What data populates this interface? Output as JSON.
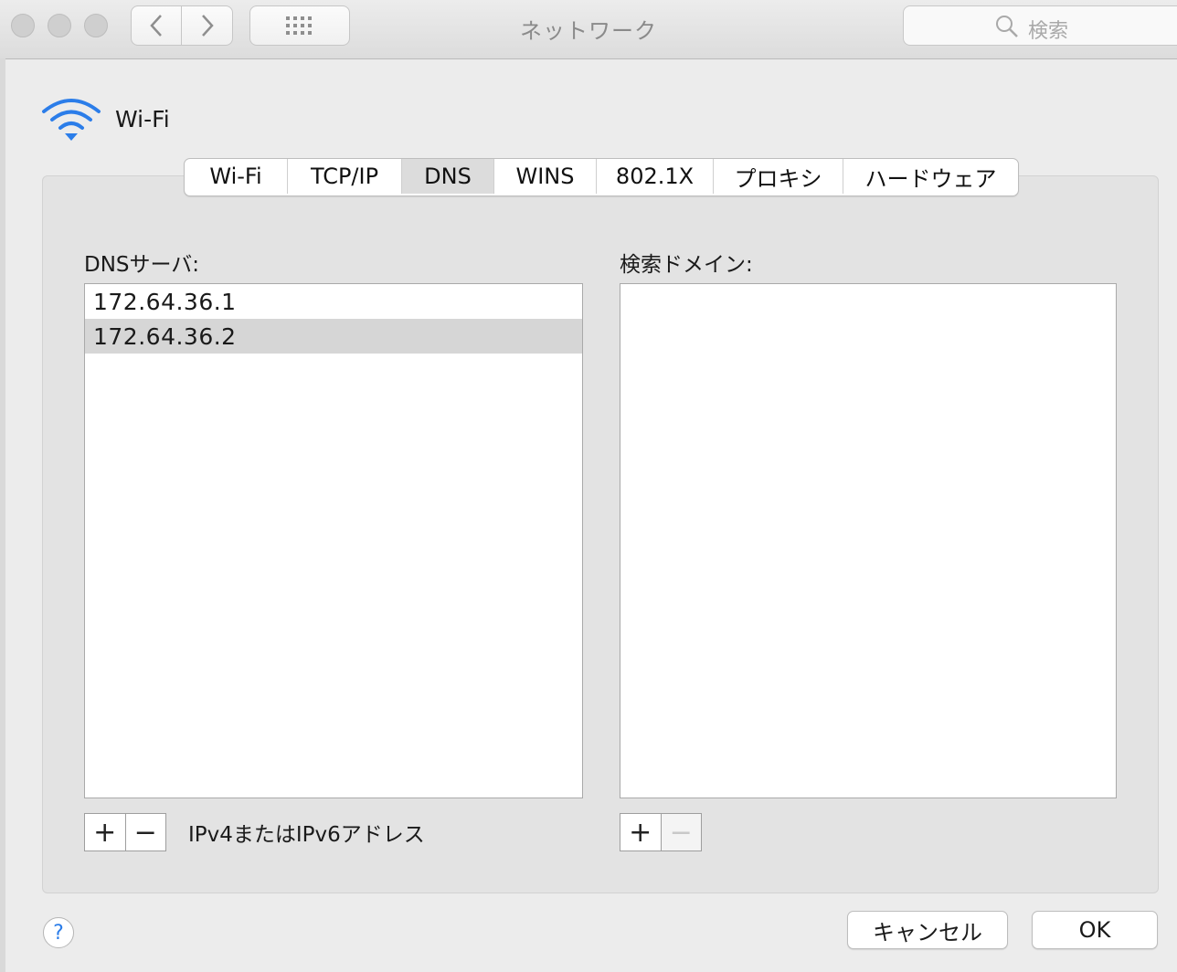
{
  "window": {
    "title": "ネットワーク",
    "search_placeholder": "検索"
  },
  "interface": {
    "name": "Wi-Fi",
    "icon": "wifi-icon",
    "accent": "#2b7de9"
  },
  "tabs": [
    {
      "label": "Wi-Fi",
      "selected": false
    },
    {
      "label": "TCP/IP",
      "selected": false
    },
    {
      "label": "DNS",
      "selected": true
    },
    {
      "label": "WINS",
      "selected": false
    },
    {
      "label": "802.1X",
      "selected": false
    },
    {
      "label": "プロキシ",
      "selected": false
    },
    {
      "label": "ハードウェア",
      "selected": false
    }
  ],
  "dns": {
    "label": "DNSサーバ:",
    "servers": [
      "172.64.36.1",
      "172.64.36.2"
    ],
    "selected_index": 1,
    "add": "+",
    "remove": "−",
    "hint": "IPv4またはIPv6アドレス"
  },
  "search_domains": {
    "label": "検索ドメイン:",
    "items": [],
    "add": "+",
    "remove": "−"
  },
  "footer": {
    "help": "?",
    "cancel": "キャンセル",
    "ok": "OK"
  }
}
